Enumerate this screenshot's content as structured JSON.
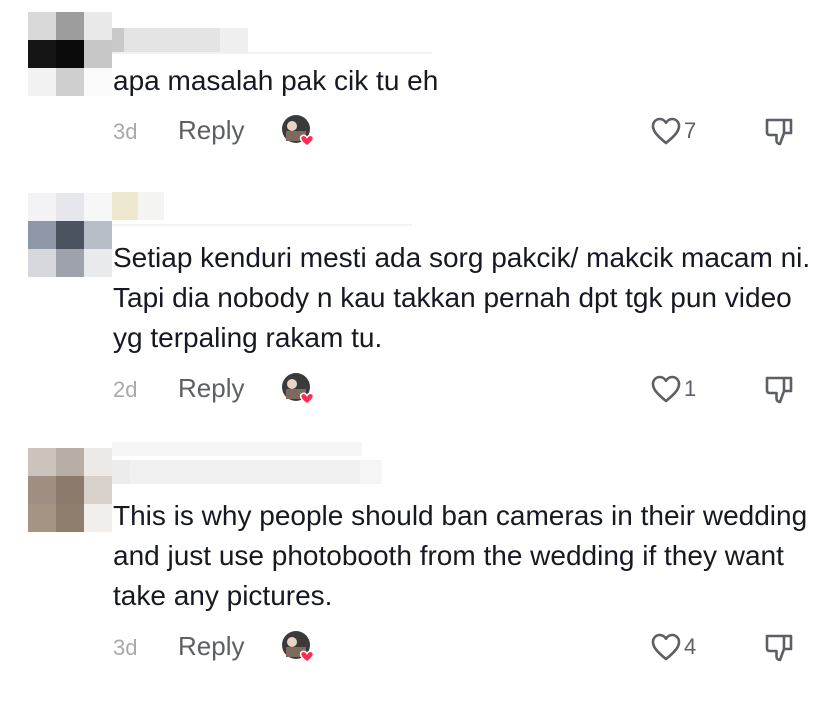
{
  "comments": [
    {
      "text": "apa masalah pak cik tu eh",
      "time": "3d",
      "reply_label": "Reply",
      "likes": "7"
    },
    {
      "text": "Setiap kenduri mesti ada sorg pakcik/ makcik macam ni. Tapi dia nobody n kau takkan pernah dpt tgk pun video yg terpaling rakam tu.",
      "time": "2d",
      "reply_label": "Reply",
      "likes": "1"
    },
    {
      "text": "This is why people should ban cameras in their wedding and just use photobooth from the wedding if they want take any pictures.",
      "time": "3d",
      "reply_label": "Reply",
      "likes": "4"
    }
  ],
  "icons": {
    "like": "heart-outline-icon",
    "dislike": "thumbs-down-icon",
    "creator_liked": "creator-avatar-heart-icon"
  },
  "colors": {
    "text": "#161823",
    "muted": "#a8a9ad",
    "reply": "#5d5f66",
    "heart_accent": "#fe2c55"
  }
}
